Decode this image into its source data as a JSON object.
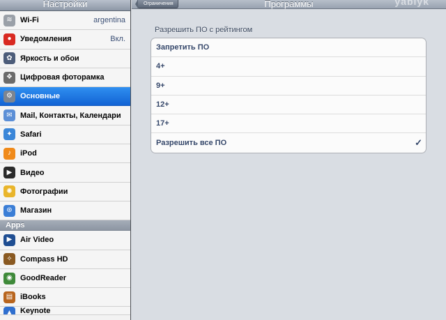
{
  "sidebar": {
    "title": "Настройки",
    "items": [
      {
        "label": "Wi-Fi",
        "value": "argentina",
        "icon": "wifi-icon",
        "color": "#9aa0a8",
        "glyph": "≋",
        "selected": false
      },
      {
        "label": "Уведомления",
        "value": "Вкл.",
        "icon": "notifications-icon",
        "color": "#d92a22",
        "glyph": "●",
        "selected": false
      },
      {
        "label": "Яркость и обои",
        "value": "",
        "icon": "brightness-icon",
        "color": "#4d5d7a",
        "glyph": "✿",
        "selected": false
      },
      {
        "label": "Цифровая фоторамка",
        "value": "",
        "icon": "picture-frame-icon",
        "color": "#6b6b6b",
        "glyph": "❖",
        "selected": false
      },
      {
        "label": "Основные",
        "value": "",
        "icon": "gear-icon",
        "color": "#7d8590",
        "glyph": "⚙",
        "selected": true
      },
      {
        "label": "Mail, Контакты, Календари",
        "value": "",
        "icon": "mail-icon",
        "color": "#5c8fd6",
        "glyph": "✉",
        "selected": false
      },
      {
        "label": "Safari",
        "value": "",
        "icon": "safari-compass-icon",
        "color": "#3a86d8",
        "glyph": "✦",
        "selected": false
      },
      {
        "label": "iPod",
        "value": "",
        "icon": "ipod-music-icon",
        "color": "#f08a1a",
        "glyph": "♪",
        "selected": false
      },
      {
        "label": "Видео",
        "value": "",
        "icon": "video-icon",
        "color": "#2b2b2b",
        "glyph": "▶",
        "selected": false
      },
      {
        "label": "Фотографии",
        "value": "",
        "icon": "photos-sunflower-icon",
        "color": "#e9b52b",
        "glyph": "✺",
        "selected": false
      },
      {
        "label": "Магазин",
        "value": "",
        "icon": "store-icon",
        "color": "#3b7ed6",
        "glyph": "⊛",
        "selected": false
      }
    ],
    "section_label": "Apps",
    "apps": [
      {
        "label": "Air Video",
        "icon": "air-video-icon",
        "color": "#1f4e92",
        "glyph": "▶"
      },
      {
        "label": "Compass HD",
        "icon": "compass-icon",
        "color": "#8a5a22",
        "glyph": "✧"
      },
      {
        "label": "GoodReader",
        "icon": "goodreader-icon",
        "color": "#3f8a3a",
        "glyph": "◉"
      },
      {
        "label": "iBooks",
        "icon": "ibooks-icon",
        "color": "#b8651e",
        "glyph": "▤"
      },
      {
        "label": "Keynote",
        "icon": "keynote-icon",
        "color": "#2f6fcf",
        "glyph": "▲"
      }
    ]
  },
  "main": {
    "title": "Программы",
    "back_label": "Ограничения",
    "watermark": "yablyk",
    "group_header": "Разрешить ПО с рейтингом",
    "options": [
      {
        "label": "Запретить ПО",
        "checked": false
      },
      {
        "label": "4+",
        "checked": false
      },
      {
        "label": "9+",
        "checked": false
      },
      {
        "label": "12+",
        "checked": false
      },
      {
        "label": "17+",
        "checked": false
      },
      {
        "label": "Разрешить все ПО",
        "checked": true
      }
    ],
    "check_glyph": "✓"
  },
  "colors": {
    "selection": "#1a74e0",
    "option_text": "#35476a"
  }
}
